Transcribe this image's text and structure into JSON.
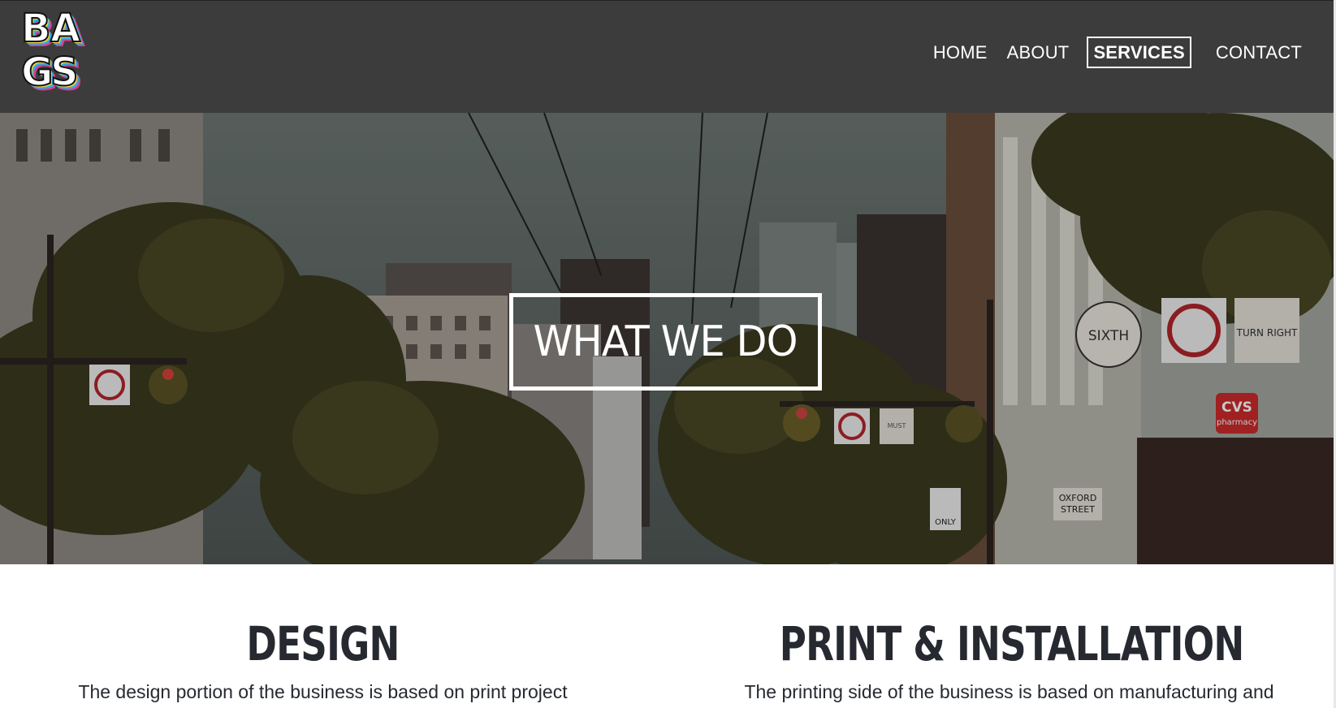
{
  "brand": {
    "logo_lines": [
      "BA",
      "GS"
    ]
  },
  "nav": {
    "items": [
      {
        "label": "HOME",
        "active": false
      },
      {
        "label": "ABOUT",
        "active": false
      },
      {
        "label": "SERVICES",
        "active": true
      },
      {
        "label": "CONTACT",
        "active": false
      }
    ]
  },
  "hero": {
    "title": "WHAT WE DO",
    "signs": {
      "sixth": "SIXTH",
      "cvs": "CVS",
      "cvs_sub": "pharmacy",
      "oxford": "OXFORD",
      "street": "STREET",
      "only": "ONLY",
      "must": "MUST",
      "turn_right": "TURN RIGHT"
    }
  },
  "services": [
    {
      "heading": "DESIGN",
      "text": "The design portion of the business is based on print project"
    },
    {
      "heading": "PRINT & INSTALLATION",
      "text": "The printing side of the business is based on manufacturing and"
    }
  ],
  "colors": {
    "header_bg": "#3c3c3c",
    "text_dark": "#262a30",
    "white": "#ffffff"
  }
}
